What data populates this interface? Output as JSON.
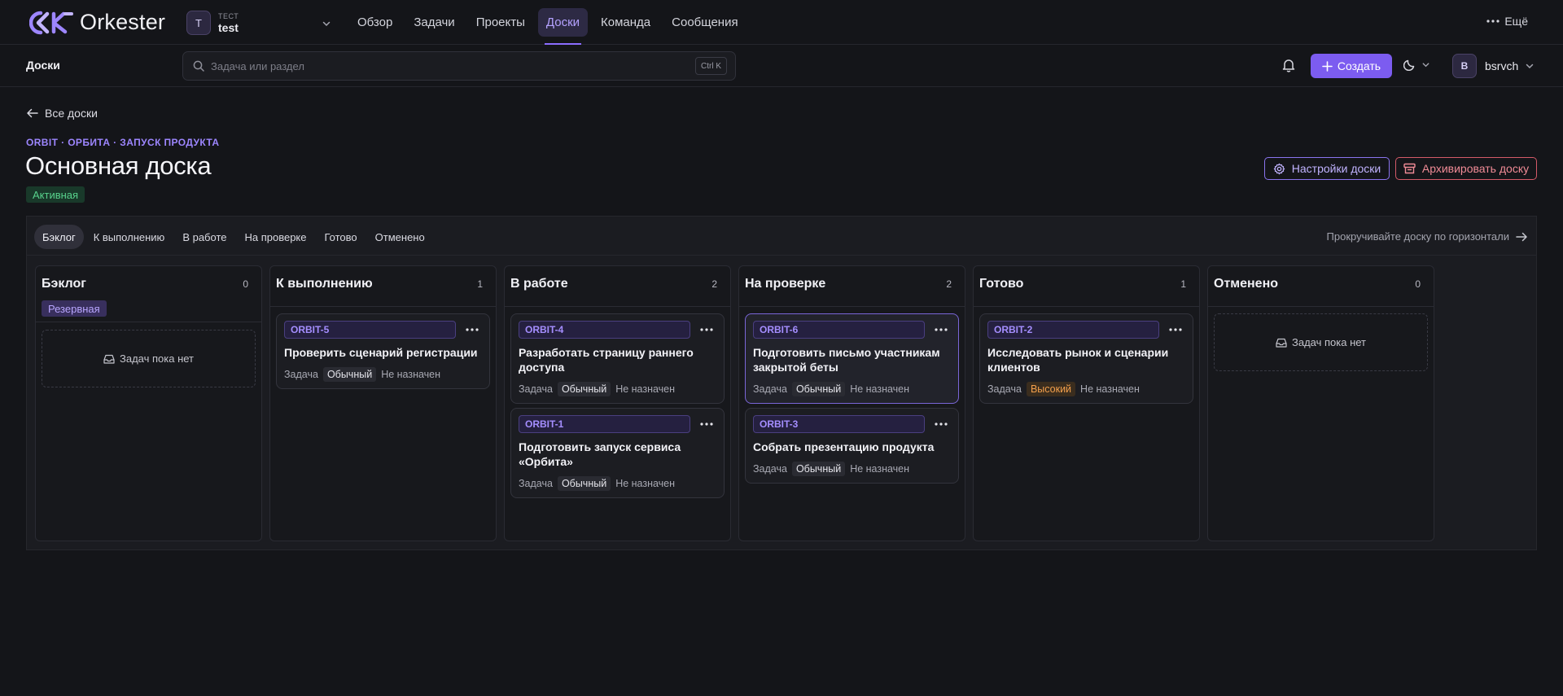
{
  "brand": {
    "name": "Orkester",
    "accent": "#8b6dff"
  },
  "workspace": {
    "label": "ТЕСТ",
    "name": "test",
    "initial": "T"
  },
  "nav": {
    "tabs": [
      {
        "label": "Обзор"
      },
      {
        "label": "Задачи"
      },
      {
        "label": "Проекты"
      },
      {
        "label": "Доски"
      },
      {
        "label": "Команда"
      },
      {
        "label": "Сообщения"
      }
    ],
    "active": "Доски",
    "more_label": "Ещё"
  },
  "subbar": {
    "section_title": "Доски",
    "search_placeholder": "Задача или раздел",
    "search_shortcut": "Ctrl K",
    "create_label": "Создать",
    "user_initial": "B",
    "user_name": "bsrvch"
  },
  "header": {
    "back_label": "Все доски",
    "breadcrumb": "ORBIT · ОРБИТА · ЗАПУСК ПРОДУКТА",
    "title": "Основная доска",
    "status": "Активная",
    "settings_label": "Настройки доски",
    "archive_label": "Архивировать доску"
  },
  "filters": {
    "items": [
      "Бэклог",
      "К выполнению",
      "В работе",
      "На проверке",
      "Готово",
      "Отменено"
    ],
    "active": "Бэклог",
    "scroll_hint": "Прокручивайте доску по горизонтали"
  },
  "empty_text": "Задач пока нет",
  "columns": [
    {
      "title": "Бэклог",
      "count": "0",
      "tag": "Резервная",
      "cards": []
    },
    {
      "title": "К выполнению",
      "count": "1",
      "cards": [
        {
          "key": "ORBIT-5",
          "title": "Проверить сценарий регистрации",
          "type": "Задача",
          "priority": "Обычный",
          "assignee": "Не назначен"
        }
      ]
    },
    {
      "title": "В работе",
      "count": "2",
      "cards": [
        {
          "key": "ORBIT-4",
          "title": "Разработать страницу раннего доступа",
          "type": "Задача",
          "priority": "Обычный",
          "assignee": "Не назначен"
        },
        {
          "key": "ORBIT-1",
          "title": "Подготовить запуск сервиса «Орбита»",
          "type": "Задача",
          "priority": "Обычный",
          "assignee": "Не назначен"
        }
      ]
    },
    {
      "title": "На проверке",
      "count": "2",
      "cards": [
        {
          "key": "ORBIT-6",
          "title": "Подготовить письмо участникам закрытой беты",
          "type": "Задача",
          "priority": "Обычный",
          "assignee": "Не назначен"
        },
        {
          "key": "ORBIT-3",
          "title": "Собрать презентацию продукта",
          "type": "Задача",
          "priority": "Обычный",
          "assignee": "Не назначен"
        }
      ]
    },
    {
      "title": "Готово",
      "count": "1",
      "cards": [
        {
          "key": "ORBIT-2",
          "title": "Исследовать рынок и сценарии клиентов",
          "type": "Задача",
          "priority": "Высокий",
          "assignee": "Не назначен"
        }
      ]
    },
    {
      "title": "Отменено",
      "count": "0",
      "cards": []
    }
  ]
}
